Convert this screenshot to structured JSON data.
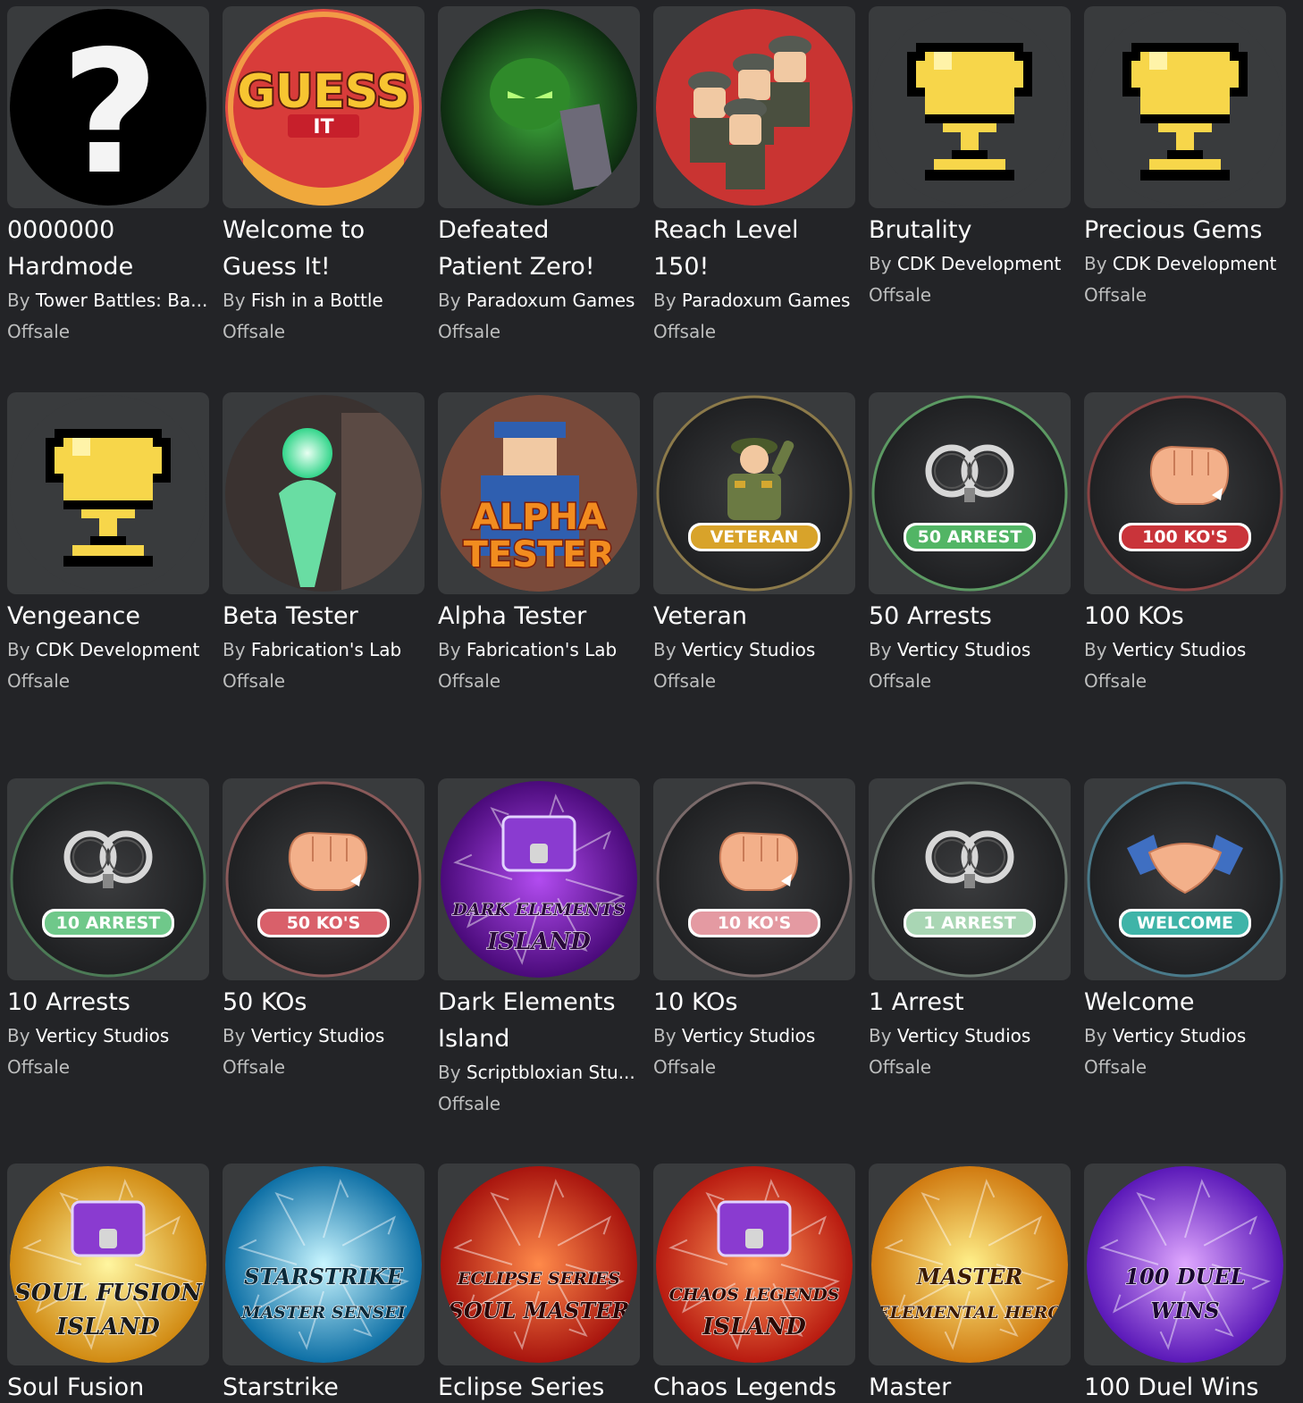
{
  "by_label": "By",
  "badges": [
    {
      "name": "0000000 Hardmode",
      "creator": "Tower Battles: Ba...",
      "price": "Offsale",
      "icon": "question-mark-icon"
    },
    {
      "name": "Welcome to Guess It!",
      "creator": "Fish in a Bottle",
      "price": "Offsale",
      "icon": "guess-it-logo",
      "art_text": [
        "GUESS",
        "IT"
      ]
    },
    {
      "name": "Defeated Patient Zero!",
      "creator": "Paradoxum Games",
      "price": "Offsale",
      "icon": "patient-zero-art"
    },
    {
      "name": "Reach Level 150!",
      "creator": "Paradoxum Games",
      "price": "Offsale",
      "icon": "soldiers-art"
    },
    {
      "name": "Brutality",
      "creator": "CDK Development",
      "price": "Offsale",
      "icon": "trophy-icon"
    },
    {
      "name": "Precious Gems",
      "creator": "CDK Development",
      "price": "Offsale",
      "icon": "trophy-icon"
    },
    {
      "name": "Vengeance",
      "creator": "CDK Development",
      "price": "Offsale",
      "icon": "trophy-icon"
    },
    {
      "name": "Beta Tester",
      "creator": "Fabrication's Lab",
      "price": "Offsale",
      "icon": "glowing-figure-art"
    },
    {
      "name": "Alpha Tester",
      "creator": "Fabrication's Lab",
      "price": "Offsale",
      "icon": "alpha-tester-art",
      "art_text": [
        "ALPHA",
        "TESTER"
      ]
    },
    {
      "name": "Veteran",
      "creator": "Verticy Studios",
      "price": "Offsale",
      "icon": "soldier-salute-icon",
      "art_text": [
        "VETERAN"
      ]
    },
    {
      "name": "50 Arrests",
      "creator": "Verticy Studios",
      "price": "Offsale",
      "icon": "handcuffs-icon",
      "art_text": [
        "50 ARREST"
      ]
    },
    {
      "name": "100 KOs",
      "creator": "Verticy Studios",
      "price": "Offsale",
      "icon": "fist-icon",
      "art_text": [
        "100 KO'S"
      ]
    },
    {
      "name": "10 Arrests",
      "creator": "Verticy Studios",
      "price": "Offsale",
      "icon": "handcuffs-icon",
      "art_text": [
        "10 ARREST"
      ]
    },
    {
      "name": "50 KOs",
      "creator": "Verticy Studios",
      "price": "Offsale",
      "icon": "fist-icon",
      "art_text": [
        "50 KO'S"
      ]
    },
    {
      "name": "Dark Elements Island",
      "creator": "Scriptbloxian Stu...",
      "price": "Offsale",
      "icon": "treasure-chest-art",
      "art_text": [
        "DARK ELEMENTS",
        "ISLAND"
      ]
    },
    {
      "name": "10 KOs",
      "creator": "Verticy Studios",
      "price": "Offsale",
      "icon": "fist-icon",
      "art_text": [
        "10 KO'S"
      ]
    },
    {
      "name": "1 Arrest",
      "creator": "Verticy Studios",
      "price": "Offsale",
      "icon": "handcuffs-icon",
      "art_text": [
        "1 ARREST"
      ]
    },
    {
      "name": "Welcome",
      "creator": "Verticy Studios",
      "price": "Offsale",
      "icon": "handshake-icon",
      "art_text": [
        "WELCOME"
      ]
    },
    {
      "name": "Soul Fusion",
      "creator": "",
      "price": "",
      "icon": "treasure-chest-art",
      "art_text": [
        "SOUL FUSION",
        "ISLAND"
      ]
    },
    {
      "name": "Starstrike",
      "creator": "",
      "price": "",
      "icon": "starstrike-art",
      "art_text": [
        "STARSTRIKE",
        "MASTER SENSEI"
      ]
    },
    {
      "name": "Eclipse Series",
      "creator": "",
      "price": "",
      "icon": "eclipse-art",
      "art_text": [
        "ECLIPSE SERIES",
        "SOUL MASTER"
      ]
    },
    {
      "name": "Chaos Legends",
      "creator": "",
      "price": "",
      "icon": "treasure-chest-art",
      "art_text": [
        "CHAOS LEGENDS",
        "ISLAND"
      ]
    },
    {
      "name": "Master",
      "creator": "",
      "price": "",
      "icon": "master-hero-art",
      "art_text": [
        "MASTER",
        "ELEMENTAL HERO"
      ]
    },
    {
      "name": "100 Duel Wins",
      "creator": "",
      "price": "",
      "icon": "duel-wins-art",
      "art_text": [
        "100 DUEL",
        "WINS"
      ]
    }
  ]
}
